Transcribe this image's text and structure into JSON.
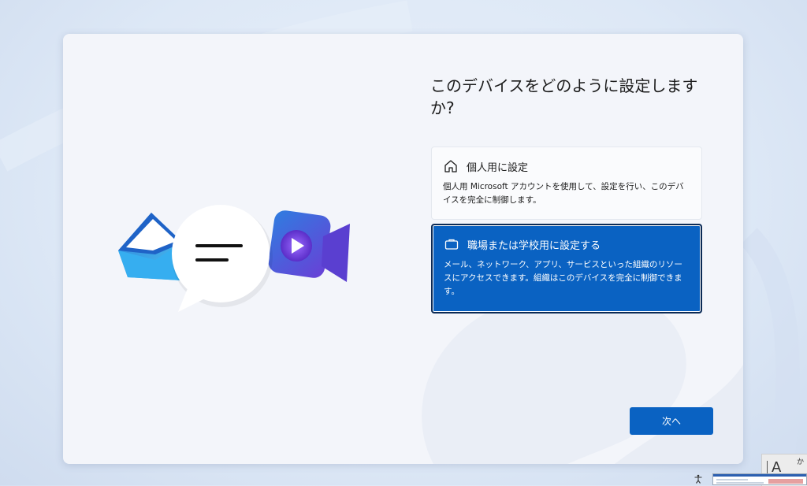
{
  "colors": {
    "accent": "#0a62c2",
    "card_background": "#f3f5fa",
    "page_background": "#dde8f6",
    "selected_border": "#0b2a55"
  },
  "page": {
    "title": "このデバイスをどのように設定しますか?"
  },
  "options": [
    {
      "icon": "home-icon",
      "title": "個人用に設定",
      "description": "個人用 Microsoft アカウントを使用して、設定を行い、このデバイスを完全に制御します。",
      "selected": false
    },
    {
      "icon": "briefcase-icon",
      "title": "職場または学校用に設定する",
      "description": "メール、ネットワーク、アプリ、サービスといった組織のリソースにアクセスできます。組織はこのデバイスを完全に制御できます。",
      "selected": true
    }
  ],
  "buttons": {
    "next_label": "次へ"
  },
  "ime": {
    "mode": "A",
    "kana": "か"
  },
  "illustration": {
    "icons": [
      "mail-icon",
      "chat-bubble-icon",
      "video-call-icon"
    ]
  }
}
